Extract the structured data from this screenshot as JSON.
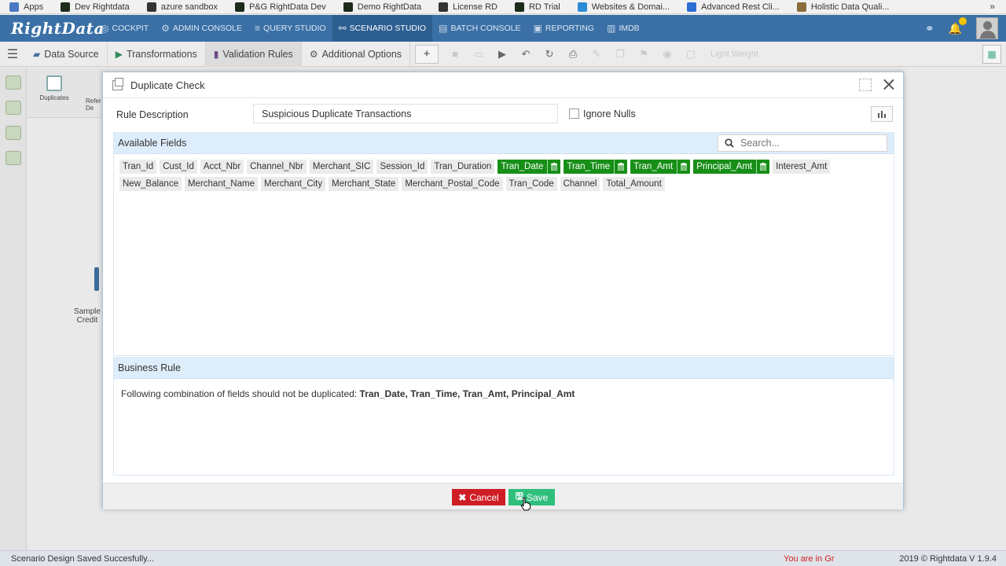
{
  "bookmarks": [
    {
      "label": "Apps",
      "icon": "apps-grid-icon",
      "color": "#4a78c2"
    },
    {
      "label": "Dev Rightdata",
      "icon": "rightdata-icon",
      "color": "#1d2b1a"
    },
    {
      "label": "azure sandbox",
      "icon": "globe-icon",
      "color": "#333333"
    },
    {
      "label": "P&G RightData Dev",
      "icon": "rightdata-icon",
      "color": "#1d2b1a"
    },
    {
      "label": "Demo RightData",
      "icon": "rightdata-icon",
      "color": "#1d2b1a"
    },
    {
      "label": "License RD",
      "icon": "globe-icon",
      "color": "#333333"
    },
    {
      "label": "RD Trial",
      "icon": "rightdata-icon",
      "color": "#1d2b1a"
    },
    {
      "label": "Websites & Domai...",
      "icon": "websites-icon",
      "color": "#2b8cd6"
    },
    {
      "label": "Advanced Rest Cli...",
      "icon": "rest-client-icon",
      "color": "#2a6fd6"
    },
    {
      "label": "Holistic Data Quali...",
      "icon": "bookmark-icon",
      "color": "#8a6d3b"
    }
  ],
  "bookmarks_more": "»",
  "app": {
    "logo": "RightData",
    "nav": [
      {
        "label": "COCKPIT",
        "icon": "cockpit-icon"
      },
      {
        "label": "ADMIN CONSOLE",
        "icon": "gear-icon"
      },
      {
        "label": "QUERY STUDIO",
        "icon": "database-icon"
      },
      {
        "label": "SCENARIO STUDIO",
        "icon": "scenario-icon",
        "active": true
      },
      {
        "label": "BATCH CONSOLE",
        "icon": "batch-icon"
      },
      {
        "label": "REPORTING",
        "icon": "report-icon"
      },
      {
        "label": "IMDB",
        "icon": "imdb-icon"
      }
    ]
  },
  "toolbar": {
    "tabs": [
      {
        "label": "Data Source",
        "icon": "data-source-icon"
      },
      {
        "label": "Transformations",
        "icon": "transformations-icon"
      },
      {
        "label": "Validation Rules",
        "icon": "validation-rules-icon",
        "active": true
      },
      {
        "label": "Additional Options",
        "icon": "gear-icon"
      }
    ],
    "add": "+",
    "light_weight": "Light Weight"
  },
  "palette": {
    "duplicates": "Duplicates",
    "refer": "Refer De"
  },
  "canvas_node": {
    "label1": "Sample",
    "label2": "Credit"
  },
  "modal": {
    "title": "Duplicate Check",
    "rule_description_label": "Rule Description",
    "rule_description_value": "Suspicious Duplicate Transactions",
    "ignore_nulls_label": "Ignore Nulls",
    "available_fields_label": "Available Fields",
    "search_placeholder": "Search...",
    "fields": [
      {
        "name": "Tran_Id",
        "selected": false
      },
      {
        "name": "Cust_Id",
        "selected": false
      },
      {
        "name": "Acct_Nbr",
        "selected": false
      },
      {
        "name": "Channel_Nbr",
        "selected": false
      },
      {
        "name": "Merchant_SIC",
        "selected": false
      },
      {
        "name": "Session_Id",
        "selected": false
      },
      {
        "name": "Tran_Duration",
        "selected": false
      },
      {
        "name": "Tran_Date",
        "selected": true
      },
      {
        "name": "Tran_Time",
        "selected": true
      },
      {
        "name": "Tran_Amt",
        "selected": true
      },
      {
        "name": "Principal_Amt",
        "selected": true
      },
      {
        "name": "Interest_Amt",
        "selected": false
      },
      {
        "name": "New_Balance",
        "selected": false
      },
      {
        "name": "Merchant_Name",
        "selected": false
      },
      {
        "name": "Merchant_City",
        "selected": false
      },
      {
        "name": "Merchant_State",
        "selected": false
      },
      {
        "name": "Merchant_Postal_Code",
        "selected": false
      },
      {
        "name": "Tran_Code",
        "selected": false
      },
      {
        "name": "Channel",
        "selected": false
      },
      {
        "name": "Total_Amount",
        "selected": false
      }
    ],
    "business_rule_label": "Business Rule",
    "business_rule_prefix": "Following combination of fields should not be duplicated:",
    "business_rule_fields": "Tran_Date, Tran_Time, Tran_Amt, Principal_Amt",
    "cancel_label": "Cancel",
    "save_label": "Save"
  },
  "status": {
    "message": "Scenario Design Saved Succesfully...",
    "alert": "You are in Gr",
    "copyright": "2019 © Rightdata V 1.9.4"
  },
  "colors": {
    "nav_bg": "#3a70a6",
    "selected_field": "#178f17",
    "cancel": "#cf1d26",
    "save": "#2fbf7d",
    "panel_header": "#deedfb"
  }
}
